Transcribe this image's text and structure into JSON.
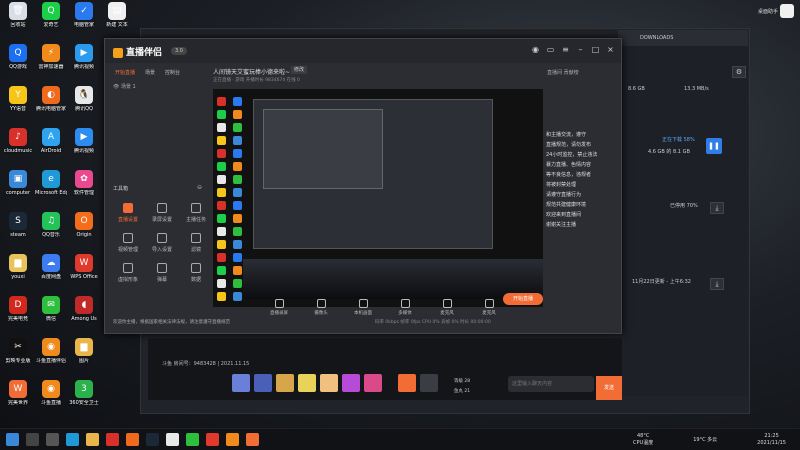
{
  "desktop": {
    "icons": [
      {
        "label": "回收站",
        "color": "#d9dee6",
        "glyph": "🗑"
      },
      {
        "label": "爱奇艺",
        "color": "#1ccf4b",
        "glyph": "Q"
      },
      {
        "label": "电脑管家",
        "color": "#2a79ee",
        "glyph": "✓"
      },
      {
        "label": "新建 文本",
        "color": "#f0f0f0",
        "glyph": "▤"
      },
      {
        "label": "QQ游戏",
        "color": "#1b6ff0",
        "glyph": "Q"
      },
      {
        "label": "雷神加速器",
        "color": "#f08a1c",
        "glyph": "⚡"
      },
      {
        "label": "腾讯视频",
        "color": "#2b9bf0",
        "glyph": "▶"
      },
      {
        "label": "YY语音",
        "color": "#f5c51a",
        "glyph": "Y"
      },
      {
        "label": "腾讯电脑管家",
        "color": "#ef6a1c",
        "glyph": "◐"
      },
      {
        "label": "腾讯QQ",
        "color": "#e8e8e8",
        "glyph": "🐧"
      },
      {
        "label": "cloudmusic",
        "color": "#d8302a",
        "glyph": "♪"
      },
      {
        "label": "AirDroid",
        "color": "#2fa3f0",
        "glyph": "A"
      },
      {
        "label": "腾讯视频",
        "color": "#2c8cf0",
        "glyph": "▶"
      },
      {
        "label": "computer",
        "color": "#3a88d8",
        "glyph": "▣"
      },
      {
        "label": "Microsoft Edge",
        "color": "#1f9ad6",
        "glyph": "e"
      },
      {
        "label": "软件管理",
        "color": "#e94a8f",
        "glyph": "✿"
      },
      {
        "label": "steam",
        "color": "#1b2838",
        "glyph": "S"
      },
      {
        "label": "QQ音乐",
        "color": "#24c35a",
        "glyph": "♫"
      },
      {
        "label": "Origin",
        "color": "#f56c1b",
        "glyph": "O"
      },
      {
        "label": "youxi",
        "color": "#e8c35a",
        "glyph": "▆"
      },
      {
        "label": "百度网盘",
        "color": "#3c7bf0",
        "glyph": "☁"
      },
      {
        "label": "WPS Office",
        "color": "#e03a2c",
        "glyph": "W"
      },
      {
        "label": "完美电竞",
        "color": "#d2291f",
        "glyph": "D"
      },
      {
        "label": "微信",
        "color": "#2fbf3e",
        "glyph": "✉"
      },
      {
        "label": "Among Us",
        "color": "#c22a2a",
        "glyph": "◖"
      },
      {
        "label": "剪映专业版",
        "color": "#111111",
        "glyph": "✂"
      },
      {
        "label": "斗鱼直播伴侣",
        "color": "#f08a1c",
        "glyph": "◉"
      },
      {
        "label": "图片",
        "color": "#e8b64a",
        "glyph": "▆"
      },
      {
        "label": "完美世界",
        "color": "#f26d36",
        "glyph": "W"
      },
      {
        "label": "斗鱼直播",
        "color": "#f08a1c",
        "glyph": "◉"
      },
      {
        "label": "360安全卫士",
        "color": "#2ab24d",
        "glyph": "3"
      }
    ],
    "topright_label": "桌面助手"
  },
  "app": {
    "logo": "直播伴侣",
    "version": "3.0",
    "sidebar_tabs": [
      "开始直播",
      "场景",
      "控制台"
    ],
    "scene": "场景 1",
    "tools_heading": "工具箱",
    "tools": [
      {
        "label": "直播设置",
        "hot": true
      },
      {
        "label": "录屏设置",
        "hot": false
      },
      {
        "label": "主播任务",
        "hot": false
      },
      {
        "label": "视频管理",
        "hot": false
      },
      {
        "label": "导入设置",
        "hot": false
      },
      {
        "label": "滤镜",
        "hot": false
      },
      {
        "label": "虚拟形象",
        "hot": false
      },
      {
        "label": "弹幕",
        "hot": false
      },
      {
        "label": "数据",
        "hot": false
      }
    ],
    "notice": "欢迎你主播，根据国家相关法律法规，请注意遵守直播规范",
    "room_title": "人间镜天艾蜜玩棒小德来啦~",
    "room_tag": "修改",
    "room_meta": "正在直播 · 游戏  开播时长  9834674  在线 0",
    "controls": [
      "直播录屏",
      "摄像头",
      "本机画面",
      "多媒体",
      "麦克风",
      "麦克风"
    ],
    "start_label": "开始直播",
    "status_line": "码率 0kbps  帧率 0fps  CPU 0%  丢帧 0%  时长 00:00:00",
    "rside_tabs": "直播间  贡献榜",
    "chat": [
      "和主播交流，遵守",
      "直播规范，请勿发布",
      "24小时监控，禁止违法",
      "暴力直播、色情内容",
      "等不良信息，违规者",
      "将被封禁处理",
      "请遵守直播行为",
      "规范共建健康环境",
      "欢迎来到直播间",
      "谢谢关注主播"
    ]
  },
  "download": {
    "title": "DOWNLOADS",
    "disk_label": "8.6 GB",
    "speed_label": "13.3 MB/s",
    "status": "正在下载 58%",
    "size_label": "4.6 GB 的 8.1 GB",
    "progress_label": "已停用 70%",
    "date_label": "11月22日更新 - 上午6:32"
  },
  "stream": {
    "room_info": "斗鱼 房间号：9483428 | 2021.11.15",
    "user_level": "等级 28",
    "user_coins": "鱼丸 21",
    "chat_placeholder": "这里输入聊天内容",
    "send": "发送"
  },
  "taskbar": {
    "temp": "48°C",
    "temp_label": "CPU温度",
    "weather": "19°C 多云",
    "time": "21:25",
    "date": "2021/11/15"
  }
}
